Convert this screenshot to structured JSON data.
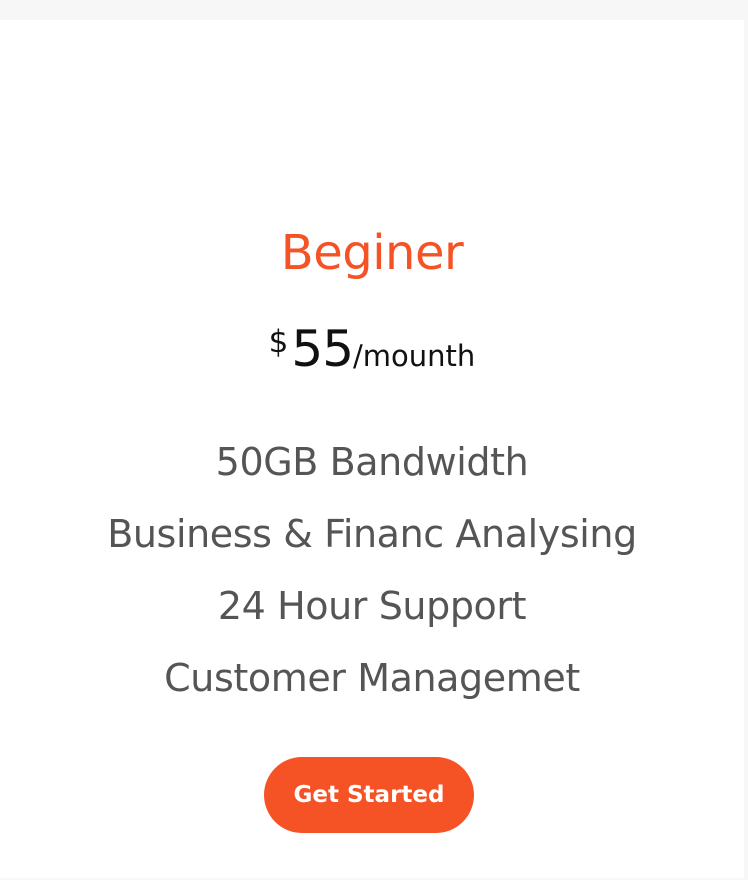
{
  "plan": {
    "name": "Beginer",
    "currency": "$",
    "amount": "55",
    "period": "/mounth",
    "features": [
      "50GB Bandwidth",
      "Business & Financ Analysing",
      "24 Hour Support",
      "Customer Managemet"
    ],
    "cta_label": "Get Started"
  },
  "colors": {
    "accent": "#f55226",
    "feature_text": "#555555",
    "price_text": "#111111",
    "card_background": "#ffffff",
    "page_background": "#f7f7f7"
  }
}
